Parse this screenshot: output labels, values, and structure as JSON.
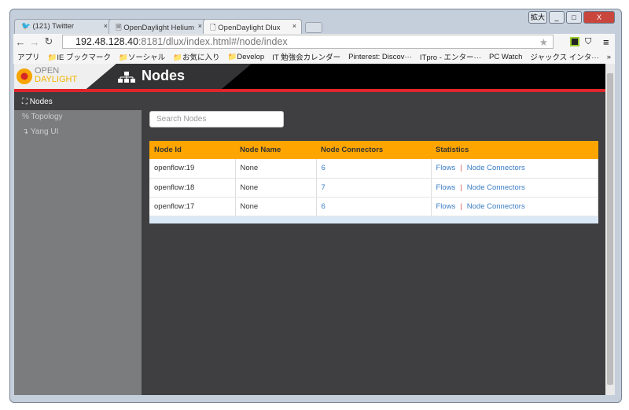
{
  "window": {
    "controls": [
      "拡大",
      "_",
      "□",
      "X"
    ]
  },
  "tabs": [
    {
      "label": "(121) Twitter",
      "icon": "twitter-icon"
    },
    {
      "label": "OpenDaylight Helium",
      "icon": "page-icon"
    },
    {
      "label": "OpenDaylight Dlux",
      "icon": "page-icon"
    }
  ],
  "address": {
    "host": "192.48.128.40",
    "rest": ":8181/dlux/index.html#/node/index"
  },
  "bookmarks": [
    "アプリ",
    "IE ブックマーク",
    "ソーシャル",
    "お気に入り",
    "Develop",
    "IT 勉強会カレンダー",
    "Pinterest: Discov···",
    "ITpro - エンター···",
    "PC Watch",
    "ジャックス インタ···",
    "»"
  ],
  "logo": {
    "line1": "OPEN",
    "line2": "DAYLIGHT"
  },
  "header": {
    "title": "Nodes"
  },
  "sidebar": {
    "items": [
      {
        "label": "Nodes",
        "icon": "⛶"
      },
      {
        "label": "Topology",
        "icon": "%"
      },
      {
        "label": "Yang UI",
        "icon": "↴"
      }
    ]
  },
  "search": {
    "placeholder": "Search Nodes"
  },
  "table": {
    "headers": [
      "Node Id",
      "Node Name",
      "Node Connectors",
      "Statistics"
    ],
    "rows": [
      {
        "id": "openflow:19",
        "name": "None",
        "connectors": "6",
        "flows": "Flows",
        "nc": "Node Connectors",
        "sep": "|"
      },
      {
        "id": "openflow:18",
        "name": "None",
        "connectors": "7",
        "flows": "Flows",
        "nc": "Node Connectors",
        "sep": "|"
      },
      {
        "id": "openflow:17",
        "name": "None",
        "connectors": "6",
        "flows": "Flows",
        "nc": "Node Connectors",
        "sep": "|"
      }
    ]
  },
  "colors": {
    "header_bar": "#ffa500",
    "accent_red": "#e0262b",
    "link": "#3a7cc4"
  }
}
